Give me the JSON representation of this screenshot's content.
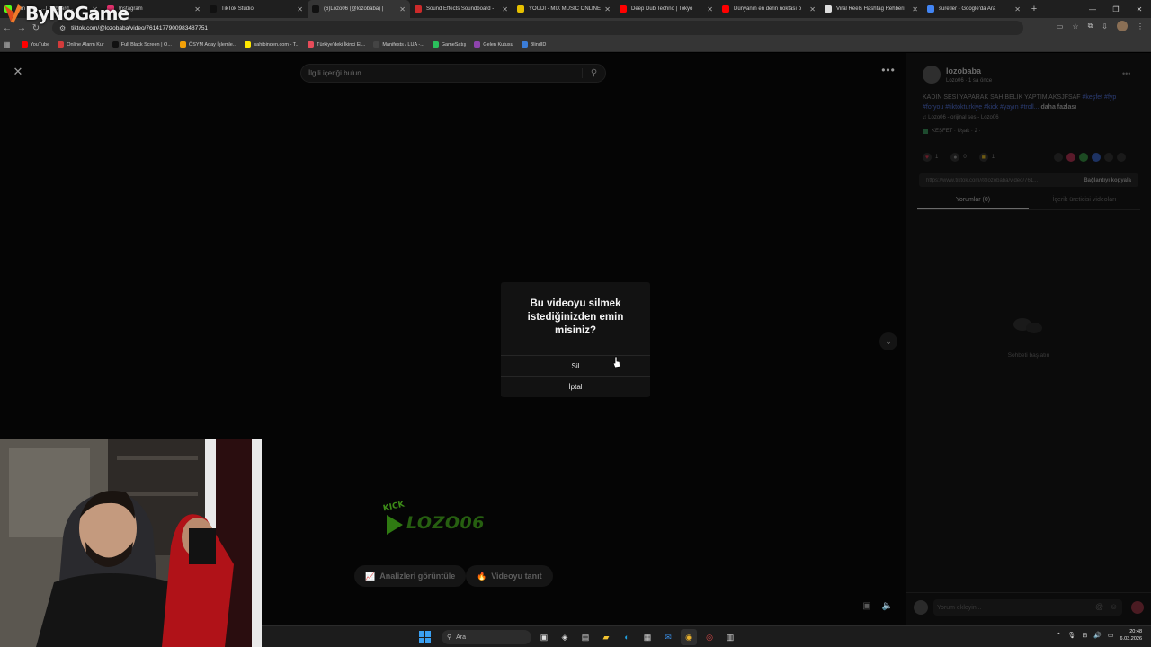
{
  "logo": {
    "text": "ByNoGame"
  },
  "tabs": [
    {
      "title": "...m - K... [...] slkboard...",
      "color": "#53fc18",
      "active": false
    },
    {
      "title": "Instagram",
      "color": "#e1306c",
      "active": false
    },
    {
      "title": "TikTok Studio",
      "color": "#111111",
      "active": false
    },
    {
      "title": "(6)Lozo06 (@lozobaba) | ",
      "color": "#111111",
      "active": true
    },
    {
      "title": "Sound Effects Soundboard - ",
      "color": "#cc2a2a",
      "active": false
    },
    {
      "title": "YOUDI - MIX MUSIC ONLINE",
      "color": "#e6c000",
      "active": false
    },
    {
      "title": "Deep Dub Techno | Tokyo",
      "color": "#ff0000",
      "active": false
    },
    {
      "title": "Dünyanın en derin noktası o",
      "color": "#ff0000",
      "active": false
    },
    {
      "title": "Viral Reels Hashtag Rehberi",
      "color": "#dddddd",
      "active": false
    },
    {
      "title": "suretler - Google'da Ara",
      "color": "#4285f4",
      "active": false
    }
  ],
  "address": {
    "url": "tiktok.com/@lozobaba/video/7614177900983487751"
  },
  "bookmarks": [
    {
      "label": "YouTube",
      "color": "#ff0000"
    },
    {
      "label": "Online Alarm Kur",
      "color": "#d23b3b"
    },
    {
      "label": "Full Black Screen | O...",
      "color": "#111111"
    },
    {
      "label": "ÖSYM Aday İşlemle...",
      "color": "#f2a007"
    },
    {
      "label": "sahibinden.com - T...",
      "color": "#ffe800"
    },
    {
      "label": "Türkiye'deki İkinci El...",
      "color": "#e74c5a"
    },
    {
      "label": "Manifests / LUA -...",
      "color": "#444444"
    },
    {
      "label": "GameSatış",
      "color": "#2bbf5c"
    },
    {
      "label": "Gelen Kutusu",
      "color": "#8e44ad"
    },
    {
      "label": "BlindID",
      "color": "#3b7dd8"
    }
  ],
  "video": {
    "search_placeholder": "İlgili içeriği bulun",
    "watermark_kick": "KICK",
    "watermark_name": "LOZO06",
    "analytics_btn": "Analizleri görüntüle",
    "promote_btn": "Videoyu tanıt"
  },
  "modal": {
    "title": "Bu videoyu silmek istediğinizden emin misiniz?",
    "delete_label": "Sil",
    "cancel_label": "İptal"
  },
  "panel": {
    "username": "lozobaba",
    "meta": "Lozo06 · 1 sa önce",
    "desc_text": "KADIN SESİ YAPARAK SAHİBELİK YAPTIM AKSJFSAF ",
    "desc_tags": "#keşfet #fyp #foryou #tiktokturkiye #kick #yayın #troll...",
    "desc_more": "daha fazlası",
    "sound": "♫ Lozo06 - orijinal ses - Lozo06",
    "place": "KEŞFET · Uşak · 2 ·",
    "likes": "1",
    "comments": "0",
    "saves": "1",
    "link": "https://www.tiktok.com/@lozobaba/video/761...",
    "copy_label": "Bağlantıyı kopyala",
    "tab_comments": "Yorumlar (0)",
    "tab_creator": "İçerik üreticisi videoları",
    "empty_chat": "Sohbeti başlatın",
    "comment_placeholder": "Yorum ekleyin..."
  },
  "taskbar": {
    "search_label": "Ara",
    "time": "20:48",
    "date": "6.03.2026"
  }
}
